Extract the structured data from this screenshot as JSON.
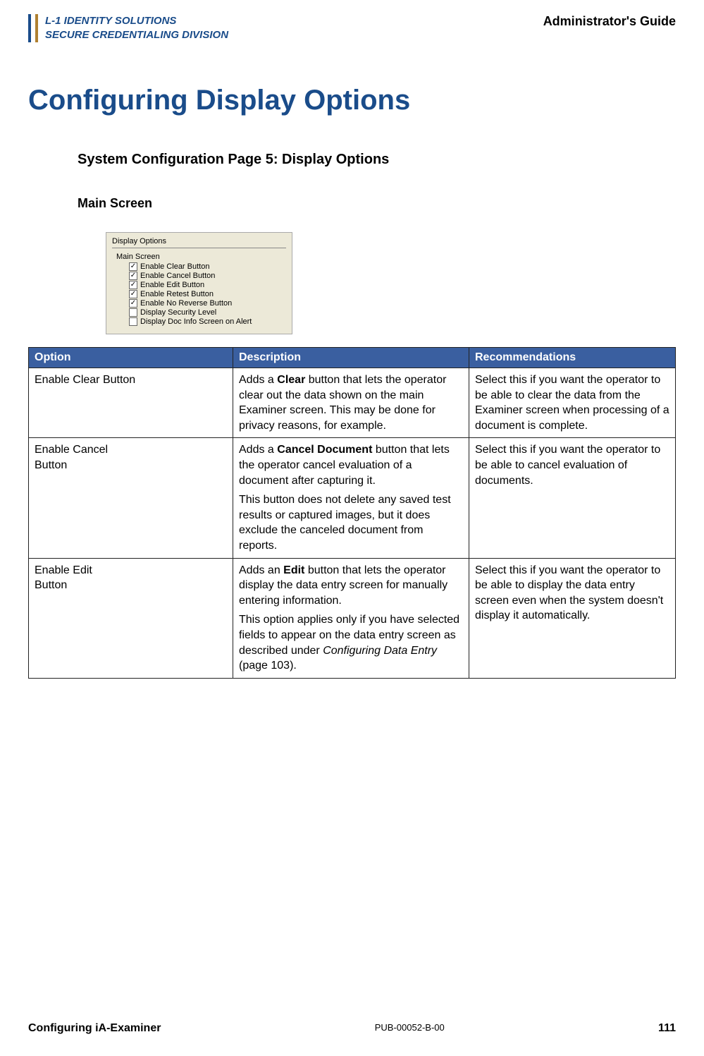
{
  "header": {
    "logo_line1": "L-1 IDENTITY SOLUTIONS",
    "logo_line2": "SECURE CREDENTIALING DIVISION",
    "guide_title": "Administrator's Guide"
  },
  "title": "Configuring Display Options",
  "subtitle": "System Configuration Page 5: Display Options",
  "screen_title": "Main Screen",
  "screenshot": {
    "panel_title": "Display Options",
    "group_label": "Main Screen",
    "items": [
      {
        "checked": true,
        "label": "Enable Clear Button"
      },
      {
        "checked": true,
        "label": "Enable Cancel Button"
      },
      {
        "checked": true,
        "label": "Enable Edit Button"
      },
      {
        "checked": true,
        "label": "Enable Retest Button"
      },
      {
        "checked": true,
        "label": "Enable No Reverse Button"
      },
      {
        "checked": false,
        "label": "Display Security Level"
      },
      {
        "checked": false,
        "label": "Display Doc Info Screen on Alert"
      }
    ]
  },
  "table": {
    "headers": {
      "option": "Option",
      "description": "Description",
      "recommendations": "Recommendations"
    },
    "rows": [
      {
        "option": "Enable Clear Button",
        "desc_pre": "Adds a ",
        "desc_bold": "Clear",
        "desc_post": " button that lets the operator clear out the data shown on the main Examiner screen.  This may be done for privacy reasons, for example.",
        "desc_p2": "",
        "rec": "Select this if you want the operator to be able to clear the data from the Examiner screen when processing of a document is complete."
      },
      {
        "option": "Enable Cancel Button",
        "desc_pre": "Adds a ",
        "desc_bold": "Cancel Document",
        "desc_post": " button that lets the operator cancel evaluation of a document after capturing it.",
        "desc_p2": "This button does not delete any saved test results or captured images, but it does exclude the canceled document from reports.",
        "rec": "Select this if you want the operator to be able to cancel evaluation of documents."
      },
      {
        "option": "Enable Edit Button",
        "desc_pre": "Adds an ",
        "desc_bold": "Edit",
        "desc_post": " button that lets the operator display the data entry screen for manually entering information.",
        "desc_p2_pre": "This option applies only if you have selected fields to appear on the data entry screen as described under ",
        "desc_p2_em": "Configuring Data Entry",
        "desc_p2_post": " (page 103).",
        "rec": "Select this if you want the operator to be able to display the data entry screen even when the system doesn't display it automatically."
      }
    ]
  },
  "footer": {
    "left": "Configuring iA-Examiner",
    "mid": "PUB-00052-B-00",
    "right": "111"
  }
}
